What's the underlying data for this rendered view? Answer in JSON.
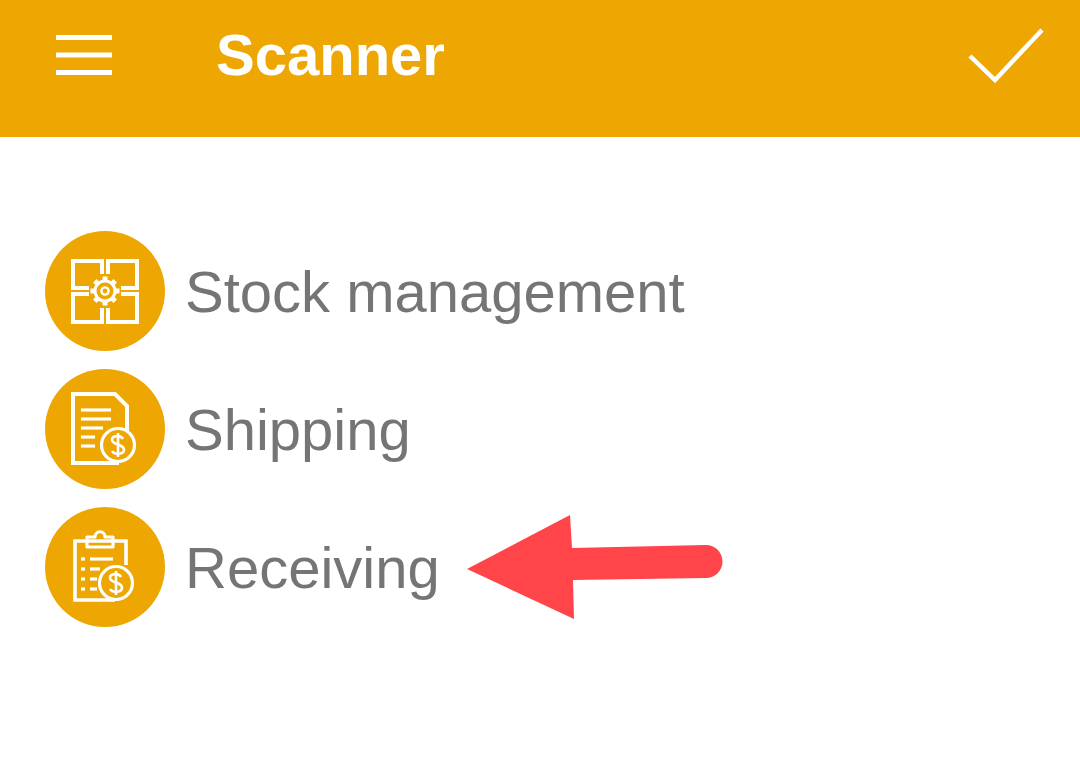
{
  "app_bar": {
    "title": "Scanner"
  },
  "items": [
    {
      "label": "Stock management",
      "kind": "stock",
      "marked_by_arrow": false
    },
    {
      "label": "Shipping",
      "kind": "shipping",
      "marked_by_arrow": false
    },
    {
      "label": "Receiving",
      "kind": "receiving",
      "marked_by_arrow": true
    }
  ]
}
